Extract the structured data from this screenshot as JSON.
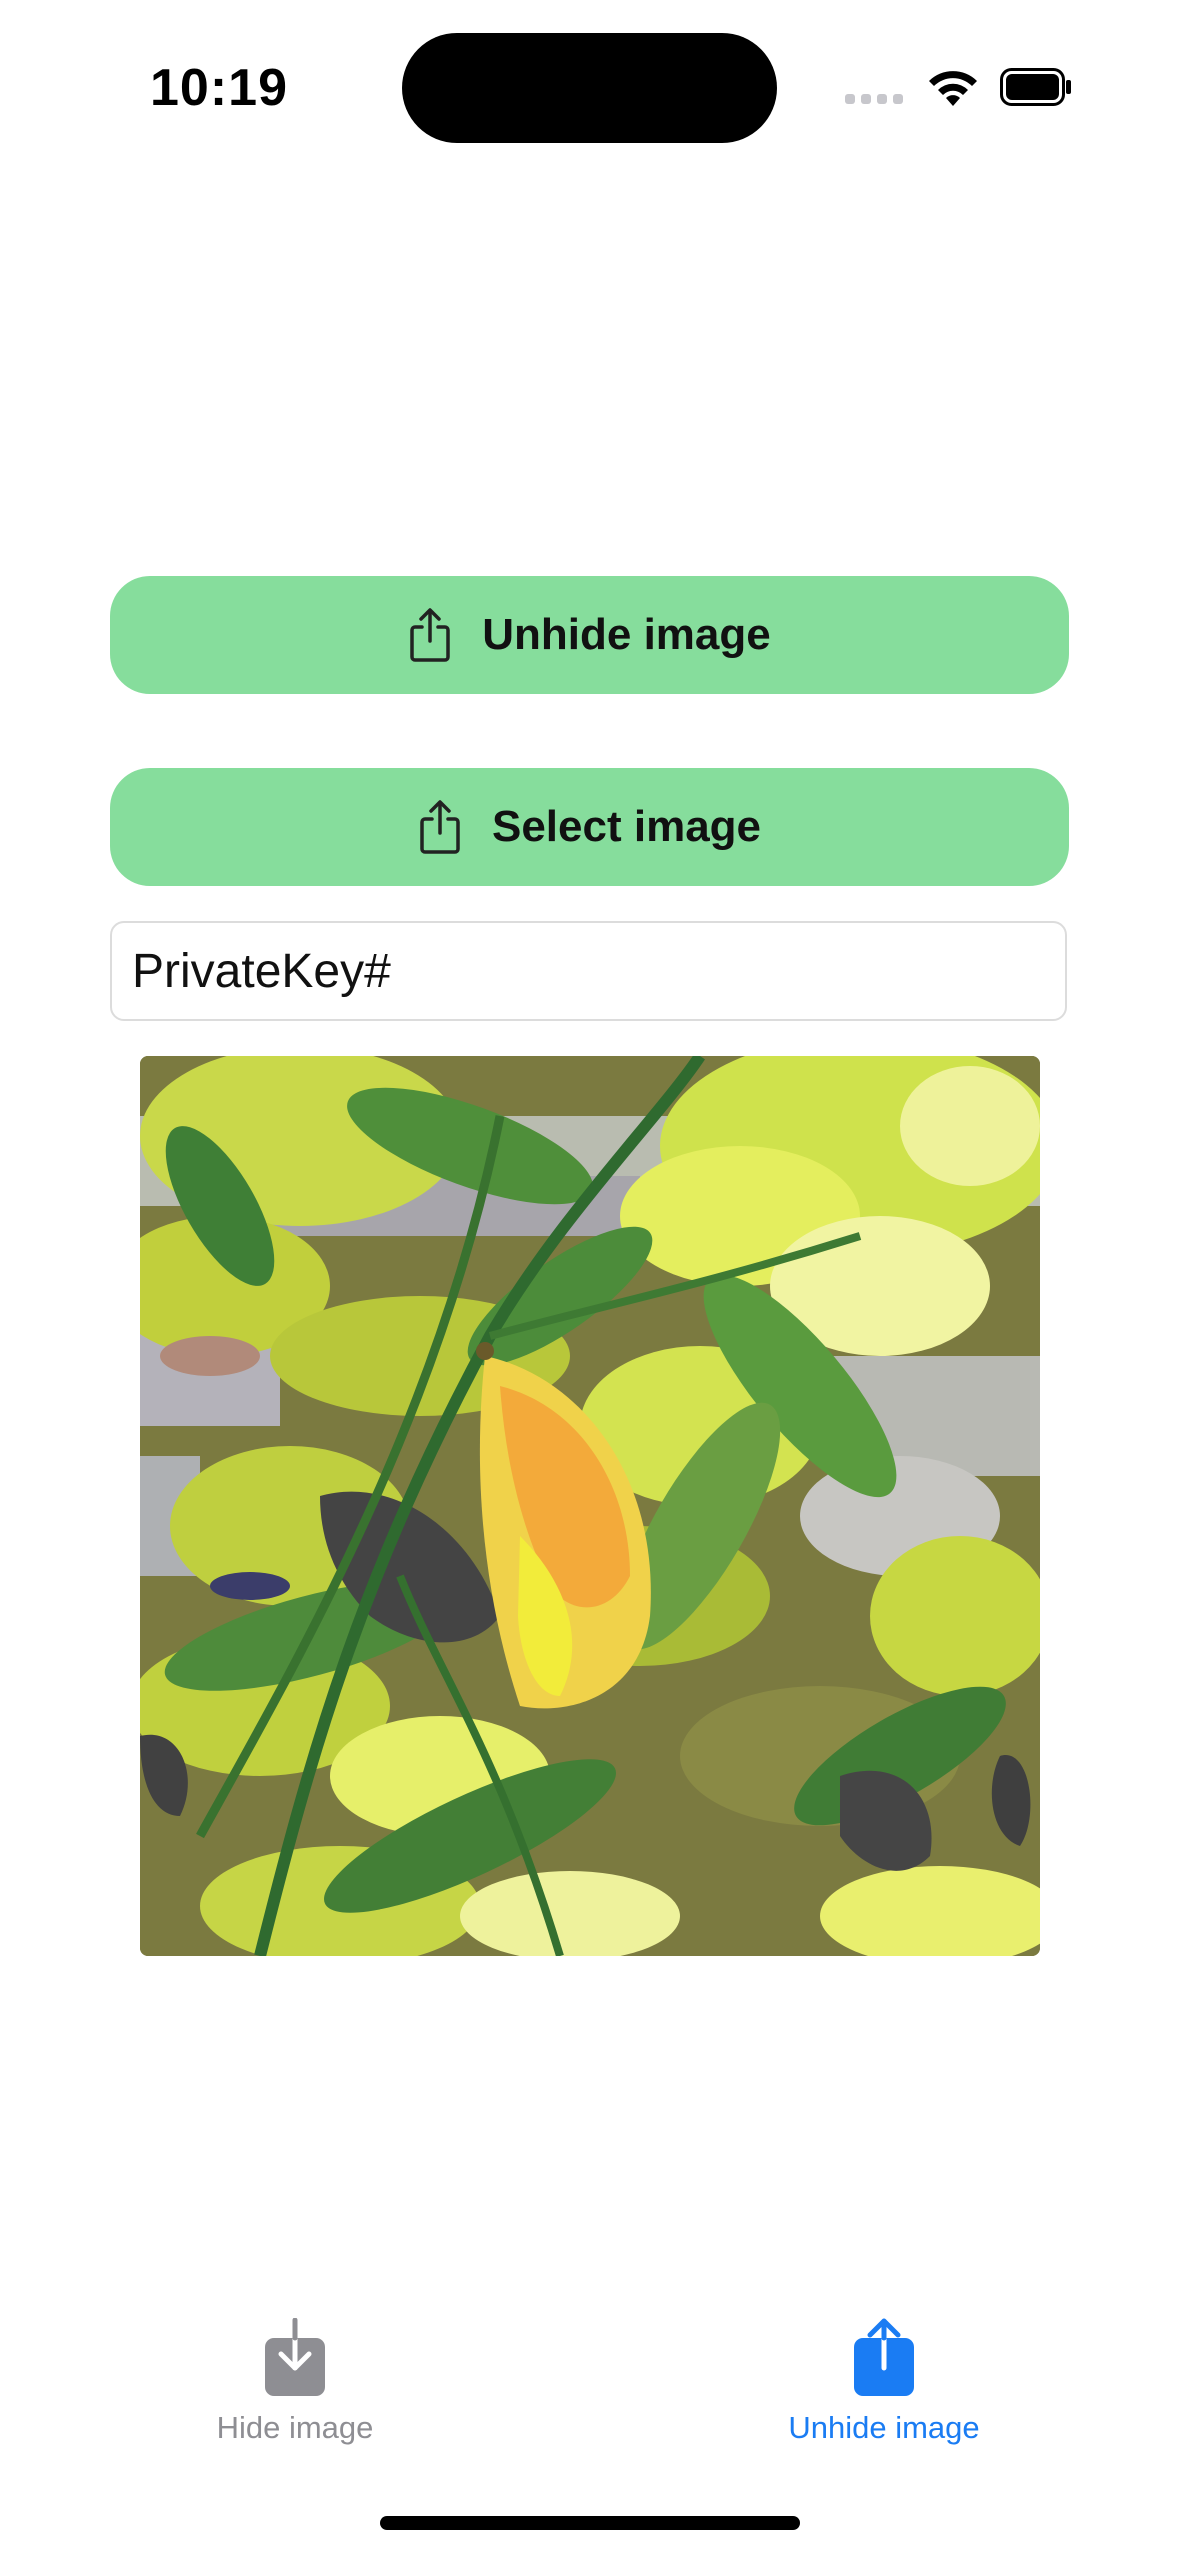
{
  "status_bar": {
    "time": "10:19"
  },
  "actions": {
    "unhide_label": "Unhide image",
    "select_label": "Select image",
    "button_color": "#86dd9c",
    "icon": "share-icon"
  },
  "key_field": {
    "value": "PrivateKey#",
    "placeholder": ""
  },
  "preview": {
    "icon": "leaf-photo"
  },
  "tab_bar": {
    "tabs": [
      {
        "label": "Hide image",
        "icon": "tray-arrow-down-icon",
        "selected": false,
        "color": "#8e8e93"
      },
      {
        "label": "Unhide image",
        "icon": "tray-arrow-up-icon",
        "selected": true,
        "color": "#1a7cf3"
      }
    ]
  }
}
